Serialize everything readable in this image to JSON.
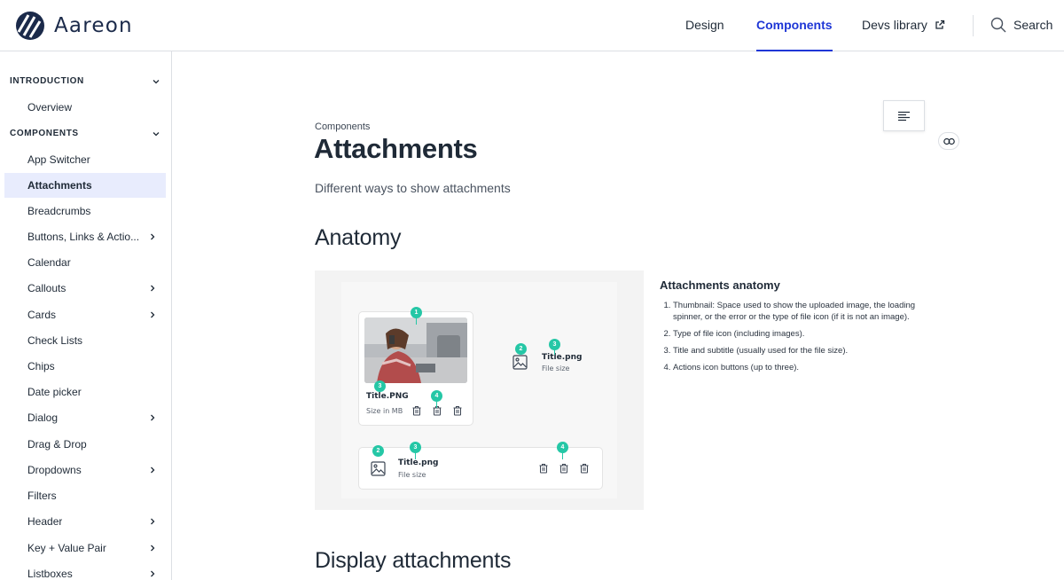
{
  "header": {
    "logo_text": "Aareon",
    "nav": [
      {
        "label": "Design",
        "active": false
      },
      {
        "label": "Components",
        "active": true
      },
      {
        "label": "Devs library",
        "active": false,
        "external": true
      }
    ],
    "search_label": "Search",
    "accent_color": "#1f37d6"
  },
  "sidebar": {
    "sections": [
      {
        "label": "INTRODUCTION",
        "items": [
          {
            "label": "Overview",
            "has_children": false
          }
        ]
      },
      {
        "label": "COMPONENTS",
        "items": [
          {
            "label": "App Switcher",
            "has_children": false
          },
          {
            "label": "Attachments",
            "has_children": false,
            "active": true
          },
          {
            "label": "Breadcrumbs",
            "has_children": false
          },
          {
            "label": "Buttons, Links & Actions",
            "display": "Buttons, Links & Actio...",
            "has_children": true
          },
          {
            "label": "Calendar",
            "has_children": false
          },
          {
            "label": "Callouts",
            "has_children": true
          },
          {
            "label": "Cards",
            "has_children": true
          },
          {
            "label": "Check Lists",
            "has_children": false
          },
          {
            "label": "Chips",
            "has_children": false
          },
          {
            "label": "Date picker",
            "has_children": false
          },
          {
            "label": "Dialog",
            "has_children": true
          },
          {
            "label": "Drag & Drop",
            "has_children": false
          },
          {
            "label": "Dropdowns",
            "has_children": true
          },
          {
            "label": "Filters",
            "has_children": false
          },
          {
            "label": "Header",
            "has_children": true
          },
          {
            "label": "Key + Value Pair",
            "has_children": true
          },
          {
            "label": "Listboxes",
            "has_children": true
          }
        ]
      }
    ]
  },
  "main": {
    "breadcrumb": "Components",
    "title": "Attachments",
    "subtitle": "Different ways to show attachments",
    "anatomy_heading": "Anatomy",
    "display_heading": "Display attachments",
    "illustration": {
      "card_thumb_title": "Title.PNG",
      "card_thumb_size": "Size in MB",
      "inline_title": "Title.png",
      "inline_size": "File size",
      "row_title": "Title.png",
      "row_size": "File size",
      "markers": [
        "1",
        "2",
        "3",
        "4"
      ],
      "marker_color": "#25c7a6"
    },
    "anatomy_desc": {
      "title": "Attachments anatomy",
      "items": [
        "Thumbnail: Space used to show the uploaded image, the loading spinner, or the error or the type of file icon (if it is not an image).",
        "Type of file icon (including images).",
        "Title and subtitle (usually used for the file size).",
        "Actions icon buttons (up to three)."
      ]
    }
  }
}
